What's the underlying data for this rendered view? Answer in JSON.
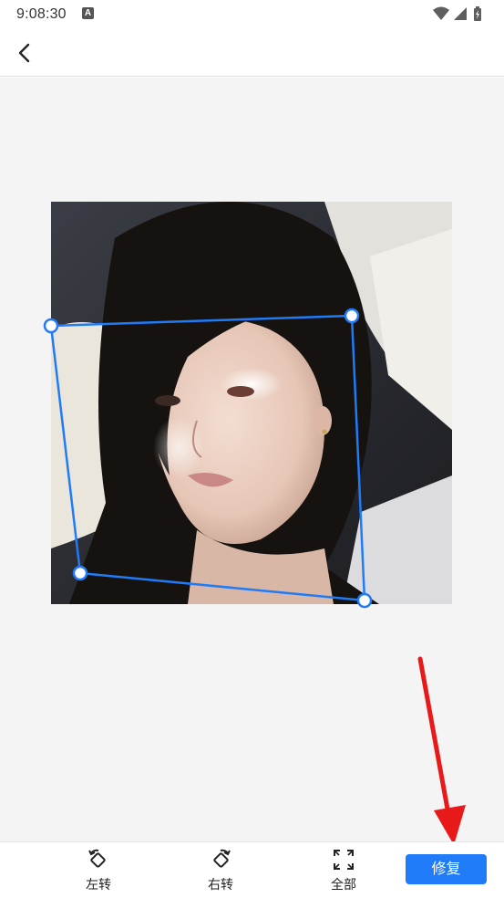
{
  "status_bar": {
    "time": "9:08:30",
    "notification_icon": "A",
    "icons": [
      "wifi-icon",
      "signal-icon",
      "battery-icon"
    ]
  },
  "app_bar": {
    "back_icon": "back-arrow-icon"
  },
  "toolbar": {
    "rotate_left_label": "左转",
    "rotate_right_label": "右转",
    "select_all_label": "全部",
    "repair_label": "修复"
  },
  "colors": {
    "accent": "#1f7bf7",
    "crop_line": "#1f7bf7",
    "pointer_arrow": "#e81919",
    "canvas_bg": "#f4f4f5"
  }
}
